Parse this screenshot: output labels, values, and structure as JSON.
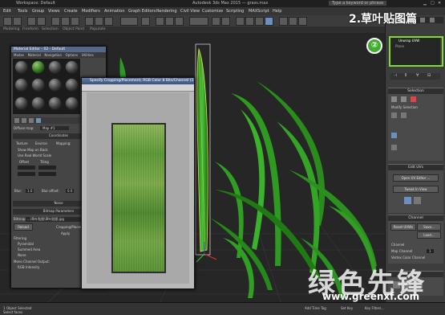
{
  "window": {
    "title": "Workspace: Default",
    "file_title": "Autodesk 3ds Max 2015 — grass.max",
    "search_placeholder": "Type a keyword or phrase"
  },
  "menubar": [
    "Edit",
    "Tools",
    "Group",
    "Views",
    "Create",
    "Modifiers",
    "Animation",
    "Graph Editors",
    "Rendering",
    "Civil View",
    "Customize",
    "Scripting",
    "MAXScript",
    "Help"
  ],
  "ribbon": [
    "Modeling",
    "Freeform",
    "Selection",
    "Object Paint",
    "Populate"
  ],
  "overlay": {
    "step_caption": "2.草叶贴图篇",
    "step_badge": "②",
    "watermark": "绿色先锋",
    "watermark_url": "www.greenxf.com"
  },
  "command_panel": {
    "modifier_list_item": "Unwrap UVW",
    "plane_label": "Plane",
    "selection_title": "Selection",
    "modify_selection": "Modify Selection",
    "edit_uvs_title": "Edit UVs",
    "open_uv_editor": "Open UV Editor ...",
    "tweak_in_view": "Tweak In View",
    "channel_title": "Channel",
    "reset_uvws": "Reset UVWs",
    "save": "Save...",
    "load": "Load...",
    "map_channel_label": "Map Channel",
    "map_channel_value": "1",
    "vertex_color_channel": "Vertex Color Channel",
    "peel_title": "Peel"
  },
  "material_editor": {
    "title": "Material Editor - 02 - Default",
    "menu": [
      "Modes",
      "Material",
      "Navigation",
      "Options",
      "Utilities"
    ],
    "map_name": "Map #1",
    "diffuse_label": "Diffuse map:",
    "coordinates_title": "Coordinates",
    "noise_title": "Noise",
    "bitmap_params_title": "Bitmap Parameters",
    "texture_opt": "Texture",
    "environ_opt": "Environ",
    "mapping_label": "Mapping:",
    "show_map_on_back": "Show Map on Back",
    "use_real_world": "Use Real-World Scale",
    "offset_label": "Offset",
    "tiling_label": "Tiling",
    "blur_label": "Blur:",
    "blur_value": "1.0",
    "blur_offset_label": "Blur offset:",
    "blur_offset_value": "0.0",
    "bitmap_path_label": "Bitmap:",
    "bitmap_path": "...\\草叶贴图\\草叶贴图.jpg",
    "reload": "Reload",
    "cropping_title": "Cropping/Placement",
    "apply_label": "Apply",
    "filtering_title": "Filtering",
    "pyramidal": "Pyramidal",
    "summed_area": "Summed Area",
    "none_opt": "None",
    "mono_output": "Mono Channel Output:",
    "rgb_intensity": "RGB Intensity"
  },
  "texture_viewer": {
    "title": "Specify Cropping/Placement, RGB Color 8 Bits/Channel (1:1)"
  },
  "status_bar": {
    "selection": "1 Object Selected",
    "prompt": "Select faces",
    "add_time_tag": "Add Time Tag",
    "set_key": "Set Key",
    "key_filters": "Key Filters..."
  },
  "colors": {
    "highlight": "#7fdc2a",
    "badge": "#3fae2a",
    "grass": "#2e9a20"
  }
}
